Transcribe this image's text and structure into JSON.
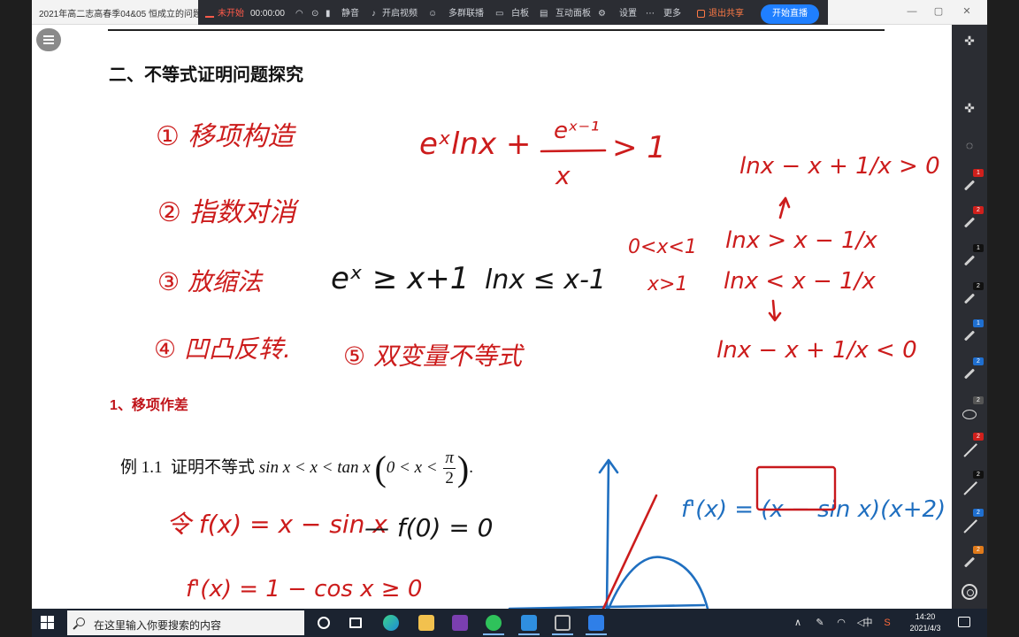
{
  "window": {
    "title": "2021年高二志高春季04&05 恒成立的问题",
    "minimize": "—",
    "maximize": "▢",
    "close": "✕"
  },
  "meeting_toolbar": {
    "recording_status": "未开始",
    "timer": "00:00:00",
    "items": [
      "静音",
      "开启视频",
      "多群联播",
      "白板",
      "互动面板",
      "设置",
      "更多"
    ],
    "end_share": "退出共享",
    "start_live": "开始直播"
  },
  "document": {
    "heading": "二、不等式证明问题探究",
    "subheading": "1、移项作差",
    "example_label": "例 1.1",
    "example_text": "证明不等式",
    "example_math_left": "sin x < x < tan x",
    "example_cond_left": "0 < x <",
    "example_pi": "π",
    "example_two": "2",
    "example_end": "."
  },
  "handwriting": {
    "methods": [
      "① 移项构造",
      "② 指数对消",
      "③ 放缩法",
      "④ 凹凸反转.",
      "⑤ 双变量不等式"
    ],
    "main_inequality_left": "eˣlnx +",
    "main_frac_num": "eˣ⁻¹",
    "main_frac_den": "x",
    "main_inequality_right": "> 1",
    "bounds_exp": "eˣ ≥ x+1",
    "bounds_ln": "lnx ≤ x-1",
    "right_top": "lnx − x + 1/x > 0",
    "right_mid1": "lnx > x − 1/x",
    "right_mid2": "lnx < x − 1/x",
    "range1": "0<x<1",
    "range2": "x>1",
    "right_bottom": "lnx − x + 1/x < 0",
    "let_fx": "令 f(x) = x − sin x",
    "f0": "— f(0) = 0",
    "fprime": "f'(x) = 1 − cos x ≥ 0",
    "fprime_blue": "f'(x) = (x − sin x)(x+2)"
  },
  "side_tools": {
    "badges": [
      "1",
      "2",
      "1",
      "2",
      "1",
      "2",
      "2",
      "2",
      "2",
      "2",
      "2"
    ],
    "badge_colors": {
      "red": "#d0201c",
      "black": "#111111",
      "blue": "#1f6fd0",
      "orange": "#e07a1a"
    }
  },
  "taskbar": {
    "search_placeholder": "在这里输入你要搜索的内容",
    "ime": "中",
    "clock_time": "14:20",
    "clock_date": "2021/4/3",
    "tray_arrow": "∧"
  }
}
